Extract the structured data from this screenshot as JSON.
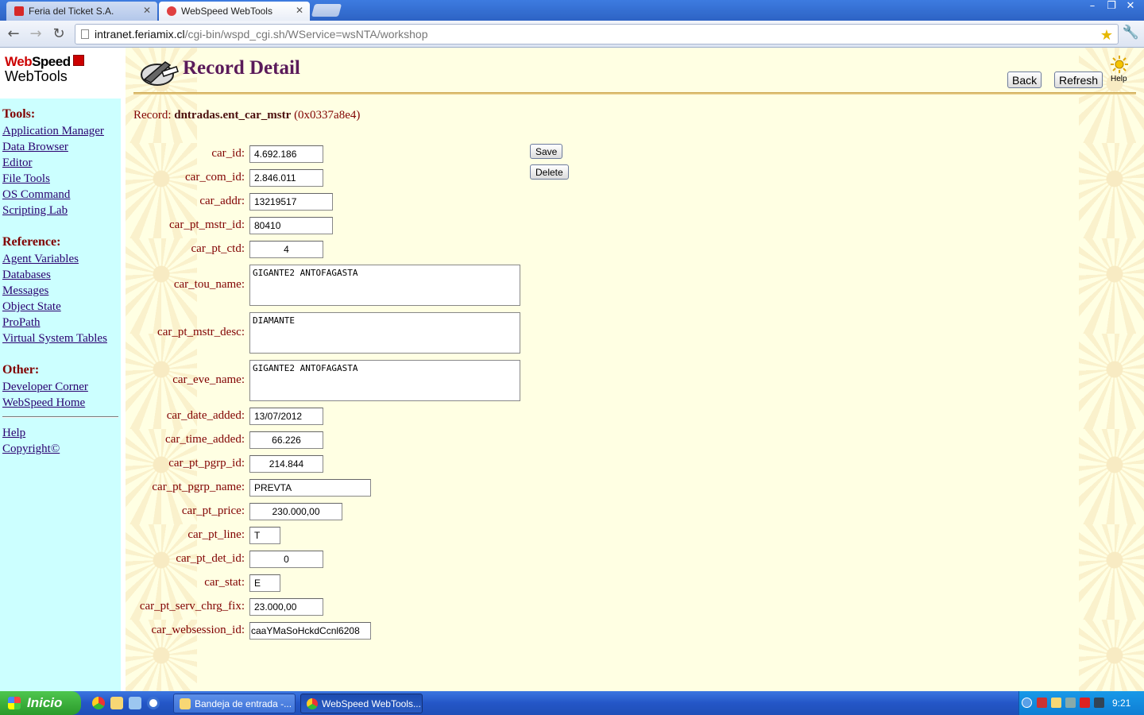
{
  "browser": {
    "tabs": [
      {
        "title": "Feria del Ticket S.A.",
        "active": false
      },
      {
        "title": "WebSpeed WebTools",
        "active": true
      }
    ],
    "url_host": "intranet.feriamix.cl",
    "url_path": "/cgi-bin/wspd_cgi.sh/WService=wsNTA/workshop"
  },
  "sidebar": {
    "logo_line1_red": "Web",
    "logo_line1_black": "Speed",
    "logo_line2": "WebTools",
    "sections": [
      {
        "title": "Tools:",
        "links": [
          "Application Manager",
          "Data Browser",
          "Editor",
          "File Tools",
          "OS Command",
          "Scripting Lab"
        ]
      },
      {
        "title": "Reference:",
        "links": [
          "Agent Variables",
          "Databases",
          "Messages",
          "Object State",
          "ProPath",
          "Virtual System Tables"
        ]
      },
      {
        "title": "Other:",
        "links": [
          "Developer Corner",
          "WebSpeed Home"
        ]
      }
    ],
    "footer_links": [
      "Help",
      "Copyright©"
    ]
  },
  "header": {
    "title": "Record Detail",
    "back_label": "Back",
    "refresh_label": "Refresh",
    "help_label": "Help"
  },
  "record": {
    "prefix": "Record:",
    "name": "dntradas.ent_car_mstr",
    "rowid": "(0x0337a8e4)"
  },
  "actions": {
    "save_label": "Save",
    "delete_label": "Delete"
  },
  "fields": [
    {
      "label": "car_id:",
      "value": "4.692.186"
    },
    {
      "label": "car_com_id:",
      "value": "2.846.011"
    },
    {
      "label": "car_addr:",
      "value": "13219517"
    },
    {
      "label": "car_pt_mstr_id:",
      "value": "80410"
    },
    {
      "label": "car_pt_ctd:",
      "value": "4"
    },
    {
      "label": "car_tou_name:",
      "value": "GIGANTE2 ANTOFAGASTA"
    },
    {
      "label": "car_pt_mstr_desc:",
      "value": "DIAMANTE"
    },
    {
      "label": "car_eve_name:",
      "value": "GIGANTE2 ANTOFAGASTA"
    },
    {
      "label": "car_date_added:",
      "value": "13/07/2012"
    },
    {
      "label": "car_time_added:",
      "value": "66.226"
    },
    {
      "label": "car_pt_pgrp_id:",
      "value": "214.844"
    },
    {
      "label": "car_pt_pgrp_name:",
      "value": "PREVTA"
    },
    {
      "label": "car_pt_price:",
      "value": "230.000,00"
    },
    {
      "label": "car_pt_line:",
      "value": "T"
    },
    {
      "label": "car_pt_det_id:",
      "value": "0"
    },
    {
      "label": "car_stat:",
      "value": "E"
    },
    {
      "label": "car_pt_serv_chrg_fix:",
      "value": "23.000,00"
    },
    {
      "label": "car_websession_id:",
      "value": "caaYMaSoHckdCcnl6208"
    }
  ],
  "taskbar": {
    "start_label": "Inicio",
    "windows": [
      {
        "title": "Bandeja de entrada -...",
        "active": false
      },
      {
        "title": "WebSpeed WebTools...",
        "active": true
      }
    ],
    "clock": "9:21"
  },
  "colors": {
    "sidebar_bg": "#ccffff",
    "page_bg": "#ffffe3",
    "label_color": "#800000",
    "link_color": "#2a0070",
    "title_color": "#5a1a5a"
  }
}
